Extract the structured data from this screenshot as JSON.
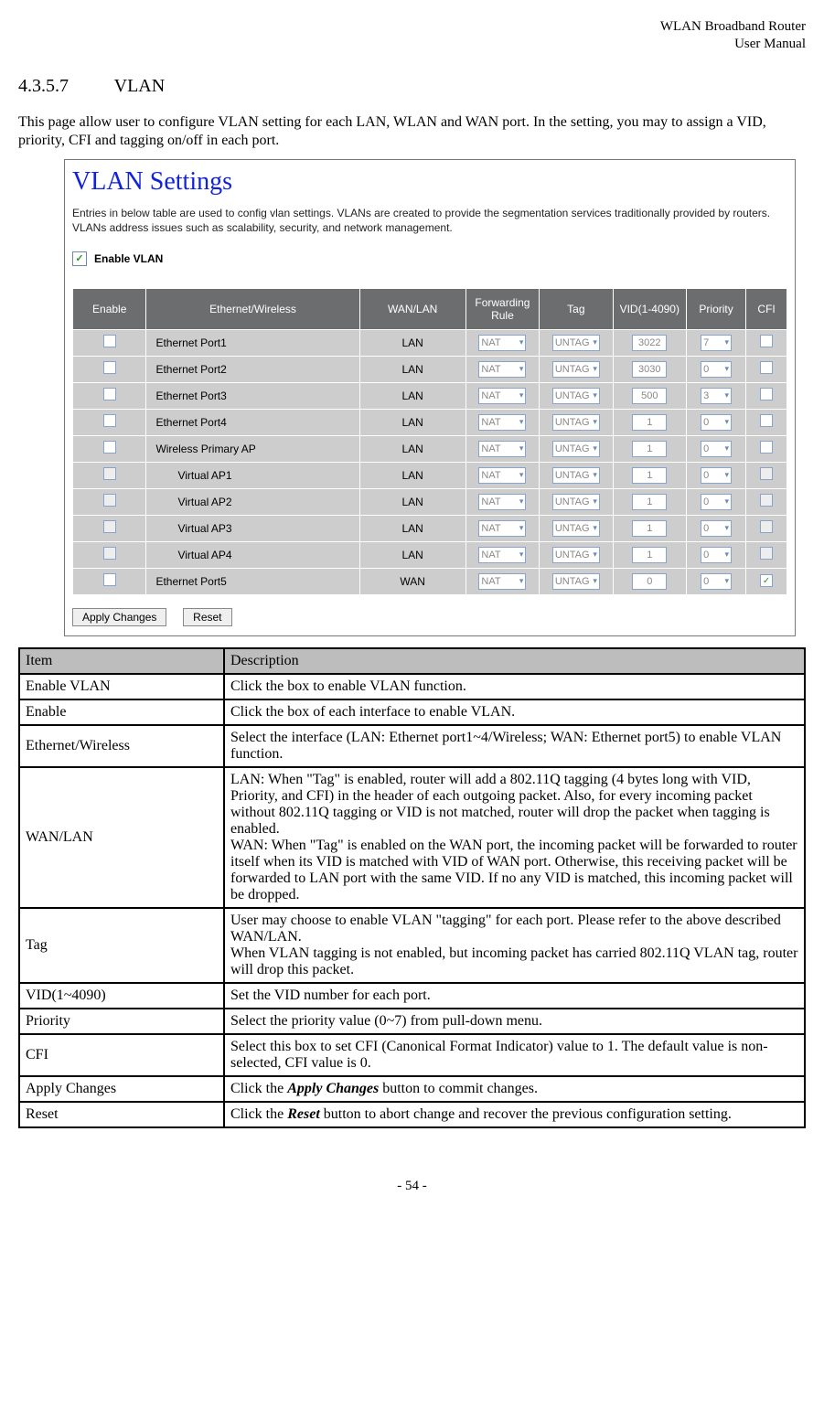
{
  "header": {
    "line1": "WLAN Broadband Router",
    "line2": "User Manual"
  },
  "section": {
    "number": "4.3.5.7",
    "title": "VLAN"
  },
  "intro": "This page allow user to configure VLAN setting for each LAN, WLAN and WAN port. In the setting, you may to assign a VID, priority, CFI and tagging on/off in each port.",
  "panel": {
    "title": "VLAN Settings",
    "desc": "Entries in below table are used to config vlan settings. VLANs are created to provide the segmentation services traditionally provided by routers. VLANs address issues such as scalability, security, and network management.",
    "enable_label": "Enable VLAN",
    "columns": {
      "enable": "Enable",
      "iface": "Ethernet/Wireless",
      "wanlan": "WAN/LAN",
      "fwd": "Forwarding Rule",
      "tag": "Tag",
      "vid": "VID(1-4090)",
      "prio": "Priority",
      "cfi": "CFI"
    },
    "rows": [
      {
        "enable": true,
        "name": "Ethernet Port1",
        "wanlan": "LAN",
        "fwd": "NAT",
        "tag": "UNTAG",
        "vid": "3022",
        "prio": "7",
        "cfi": false,
        "indent": false,
        "dis": false
      },
      {
        "enable": true,
        "name": "Ethernet Port2",
        "wanlan": "LAN",
        "fwd": "NAT",
        "tag": "UNTAG",
        "vid": "3030",
        "prio": "0",
        "cfi": false,
        "indent": false,
        "dis": false
      },
      {
        "enable": true,
        "name": "Ethernet Port3",
        "wanlan": "LAN",
        "fwd": "NAT",
        "tag": "UNTAG",
        "vid": "500",
        "prio": "3",
        "cfi": false,
        "indent": false,
        "dis": false
      },
      {
        "enable": true,
        "name": "Ethernet Port4",
        "wanlan": "LAN",
        "fwd": "NAT",
        "tag": "UNTAG",
        "vid": "1",
        "prio": "0",
        "cfi": false,
        "indent": false,
        "dis": false
      },
      {
        "enable": true,
        "name": "Wireless Primary AP",
        "wanlan": "LAN",
        "fwd": "NAT",
        "tag": "UNTAG",
        "vid": "1",
        "prio": "0",
        "cfi": false,
        "indent": false,
        "dis": false
      },
      {
        "enable": false,
        "name": "Virtual AP1",
        "wanlan": "LAN",
        "fwd": "NAT",
        "tag": "UNTAG",
        "vid": "1",
        "prio": "0",
        "cfi": false,
        "indent": true,
        "dis": true
      },
      {
        "enable": false,
        "name": "Virtual AP2",
        "wanlan": "LAN",
        "fwd": "NAT",
        "tag": "UNTAG",
        "vid": "1",
        "prio": "0",
        "cfi": false,
        "indent": true,
        "dis": true
      },
      {
        "enable": false,
        "name": "Virtual AP3",
        "wanlan": "LAN",
        "fwd": "NAT",
        "tag": "UNTAG",
        "vid": "1",
        "prio": "0",
        "cfi": false,
        "indent": true,
        "dis": true
      },
      {
        "enable": false,
        "name": "Virtual AP4",
        "wanlan": "LAN",
        "fwd": "NAT",
        "tag": "UNTAG",
        "vid": "1",
        "prio": "0",
        "cfi": false,
        "indent": true,
        "dis": true
      },
      {
        "enable": true,
        "name": "Ethernet Port5",
        "wanlan": "WAN",
        "fwd": "NAT",
        "tag": "UNTAG",
        "vid": "0",
        "prio": "0",
        "cfi": true,
        "indent": false,
        "dis": false
      }
    ],
    "buttons": {
      "apply": "Apply Changes",
      "reset": "Reset"
    }
  },
  "desc_table": {
    "head": {
      "item": "Item",
      "desc": "Description"
    },
    "rows": [
      {
        "item": "Enable VLAN",
        "desc": "Click the box to enable VLAN function."
      },
      {
        "item": "Enable",
        "desc": "Click the box of each interface to enable VLAN."
      },
      {
        "item": "Ethernet/Wireless",
        "desc": "Select the interface (LAN: Ethernet port1~4/Wireless; WAN: Ethernet port5) to enable VLAN function."
      },
      {
        "item": "WAN/LAN",
        "desc": "LAN: When \"Tag\" is enabled, router will add a 802.11Q tagging (4 bytes long with VID, Priority, and CFI) in the header of each outgoing packet. Also, for every incoming packet without 802.11Q tagging or VID is not matched, router will drop the packet when tagging is enabled.\nWAN: When \"Tag\" is enabled on the WAN port, the incoming packet will be forwarded to router itself when its VID is matched with VID of WAN port. Otherwise, this receiving packet will be forwarded to LAN port with the same VID. If no any VID is matched, this incoming packet will be dropped."
      },
      {
        "item": "Tag",
        "desc": "User may choose to enable VLAN \"tagging\" for each port. Please refer to the above described WAN/LAN.\nWhen VLAN tagging is not enabled, but incoming packet has carried 802.11Q VLAN tag, router will drop this packet."
      },
      {
        "item": "VID(1~4090)",
        "desc": "Set the VID number for each port."
      },
      {
        "item": "Priority",
        "desc": "Select the priority value (0~7) from pull-down menu."
      },
      {
        "item": "CFI",
        "desc": "Select this box to set CFI (Canonical Format Indicator) value to 1. The default value is non-selected, CFI value is 0."
      },
      {
        "item": "Apply Changes",
        "desc_html": "Click the <span class='bi'>Apply Changes</span> button to commit changes."
      },
      {
        "item": "Reset",
        "desc_html": "Click the <span class='bi'>Reset</span> button to abort change and recover the previous configuration setting."
      }
    ]
  },
  "footer": "- 54 -"
}
